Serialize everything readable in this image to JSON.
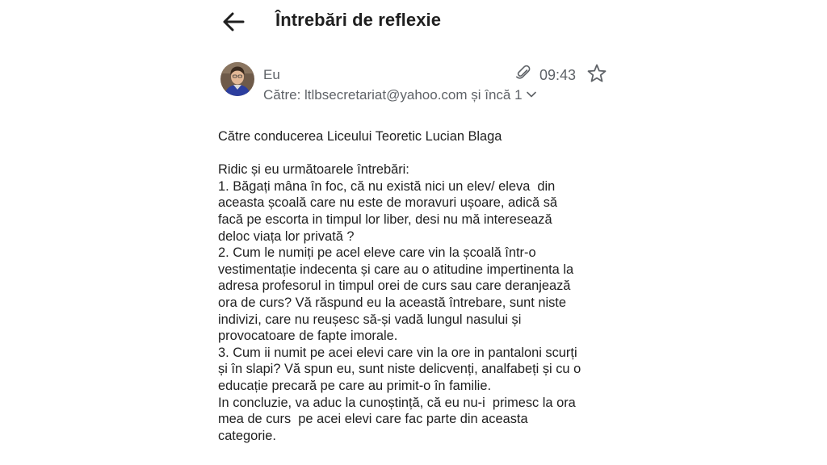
{
  "header": {
    "back_icon": "arrow-left-icon",
    "subject": "Întrebări de reflexie"
  },
  "message": {
    "avatar_icon": "user-avatar",
    "sender": "Eu",
    "recipients": "Către: ltlbsecretariat@yahoo.com și încă 1",
    "expand_icon": "chevron-down-icon",
    "attachment_icon": "paperclip-icon",
    "time": "09:43",
    "star_icon": "star-outline-icon"
  },
  "body": {
    "lines": [
      "Către conducerea Liceului Teoretic Lucian Blaga",
      "",
      "Ridic și eu următoarele întrebări:",
      "1. Băgați mâna în foc, că nu există nici un elev/ eleva  din",
      "aceasta școală care nu este de moravuri ușoare, adică să",
      "facă pe escorta in timpul lor liber, desi nu mă interesează",
      "deloc viața lor privată ?",
      "2. Cum le numiți pe acel eleve care vin la școală într-o",
      "vestimentație indecenta și care au o atitudine impertinenta la",
      "adresa profesorul in timpul orei de curs sau care deranjează",
      "ora de curs? Vă răspund eu la această întrebare, sunt niste",
      "indivizi, care nu reușesc să-și vadă lungul nasului și",
      "provocatoare de fapte imorale.",
      "3. Cum ii numit pe acei elevi care vin la ore in pantaloni scurți",
      "și în slapi? Vă spun eu, sunt niste delicvenți, analfabeți și cu o",
      "educație precară pe care au primit-o în familie.",
      "In concluzie, va aduc la cunoștință, că eu nu-i  primesc la ora",
      "mea de curs  pe acei elevi care fac parte din aceasta",
      "categorie."
    ]
  },
  "colors": {
    "text_primary": "#1f1f1f",
    "text_secondary": "#5f6368",
    "background": "#ffffff"
  }
}
